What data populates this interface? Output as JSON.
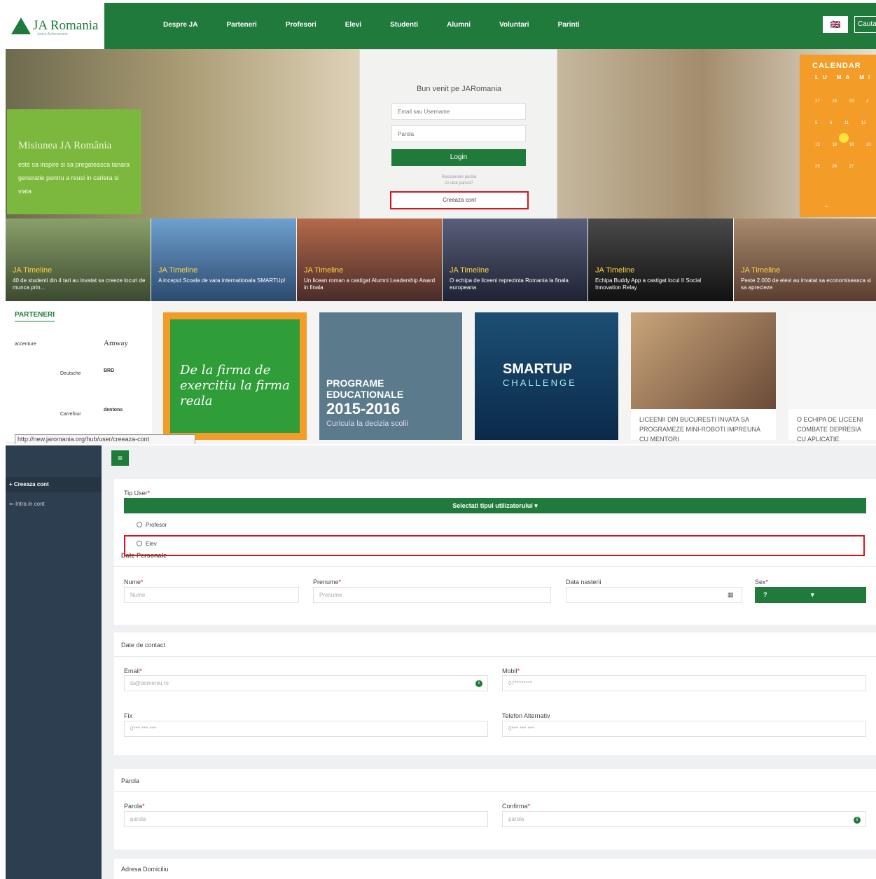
{
  "site": {
    "logo_text": "JA Romania",
    "logo_subtitle": "Junior Achievement",
    "nav": [
      "Despre JA",
      "Parteneri",
      "Profesori",
      "Elevi",
      "Studenti",
      "Alumni",
      "Voluntari",
      "Parinti"
    ],
    "lang_flag": "🇬🇧",
    "search_label": "Cauta"
  },
  "mission": {
    "title": "Misiunea JA România",
    "text": "este sa inspire si sa pregateasca tanara generatie pentru a reusi in cariera si viata"
  },
  "login": {
    "title": "Bun venit pe JARomania",
    "email_placeholder": "Email sau Username",
    "password_placeholder": "Parola",
    "login_label": "Login",
    "forgot_1": "Recuperare parola",
    "forgot_2": "Ai uitat parola?",
    "create_label": "Creeaza cont"
  },
  "calendar": {
    "title": "CALENDAR",
    "days": "LU MA MI",
    "numbers": "27 28 29 4 5 6 11 12 13 18 19 20 25 26 27",
    "today": "12",
    "nav_prev": "←"
  },
  "tiles": [
    {
      "heading": "JA Timeline",
      "text": "40 de studenti din 4 tari au invatat sa creeze locuri de munca prin..."
    },
    {
      "heading": "JA Timeline",
      "text": "A inceput Scoala de vara internationala SMARTUp!"
    },
    {
      "heading": "JA Timeline",
      "text": "Un licean roman a castigat Alumni Leadership Award in finala"
    },
    {
      "heading": "JA Timeline",
      "text": "O echipa de liceeni reprezinta Romania la finala europeana"
    },
    {
      "heading": "JA Timeline",
      "text": "Echipa Buddy App a castigat locul II Social Innovation Relay"
    },
    {
      "heading": "JA Timeline",
      "text": "Peste 2.000 de elevi au invatat sa economiseasca si sa aprecieze"
    }
  ],
  "partners": {
    "title": "PARTENERI",
    "logos": [
      "accenture",
      "Amway",
      "BRD",
      "Carrefour",
      "Deutsche",
      "dentons"
    ]
  },
  "cards": {
    "firma": "De la firma de exercitiu la firma reala",
    "prog_1": "PROGRAME EDUCATIONALE",
    "prog_2": "2015-2016",
    "prog_3": "Curicula la decizia scolii",
    "smart_1": "SMARTUP",
    "smart_2": "CHALLENGE",
    "liceeni": "LICEENII DIN BUCURESTI INVATA SA PROGRAMEZE MINI-ROBOTI IMPREUNA CU MENTORI",
    "echipa": "O ECHIPA DE LICEENI COMBATE DEPRESIA CU APLICATIE PENTRU..."
  },
  "status_url": "http://new.jaromania.org/hub/user/creeaza-cont",
  "form": {
    "sidebar": {
      "active": "Creeaza cont",
      "login": "Intra in cont",
      "active_icon": "+",
      "login_icon": "⇐"
    },
    "menu_icon": "≡",
    "tip_user_label": "Tip User",
    "select_label": "Selectati tipul utilizatorului",
    "options": [
      "Profesor",
      "Elev"
    ],
    "date_personale_label": "Date Personale",
    "nume_label": "Nume",
    "nume_placeholder": "Nume",
    "prenume_label": "Prenume",
    "prenume_placeholder": "Prenume",
    "data_label": "Data nasterii",
    "sex_label": "Sex",
    "sex_value": "?",
    "contact_heading": "Date de contact",
    "email_label": "Email",
    "email_placeholder": "ta@domeniu.ro",
    "mobil_label": "Mobil",
    "mobil_placeholder": "07********",
    "fix_label": "Fix",
    "fix_placeholder": "0*** *** ***",
    "tel_alt_label": "Telefon Alternativ",
    "tel_alt_placeholder": "0*** *** ***",
    "parola_heading": "Parola",
    "parola_label": "Parola",
    "parola_placeholder": "parola",
    "confirma_label": "Confirma",
    "confirma_placeholder": "parola",
    "adresa_heading": "Adresa Domiciliu",
    "required_mark": "*",
    "info_glyph": "i",
    "calendar_glyph": "▦",
    "caret": "▾"
  }
}
